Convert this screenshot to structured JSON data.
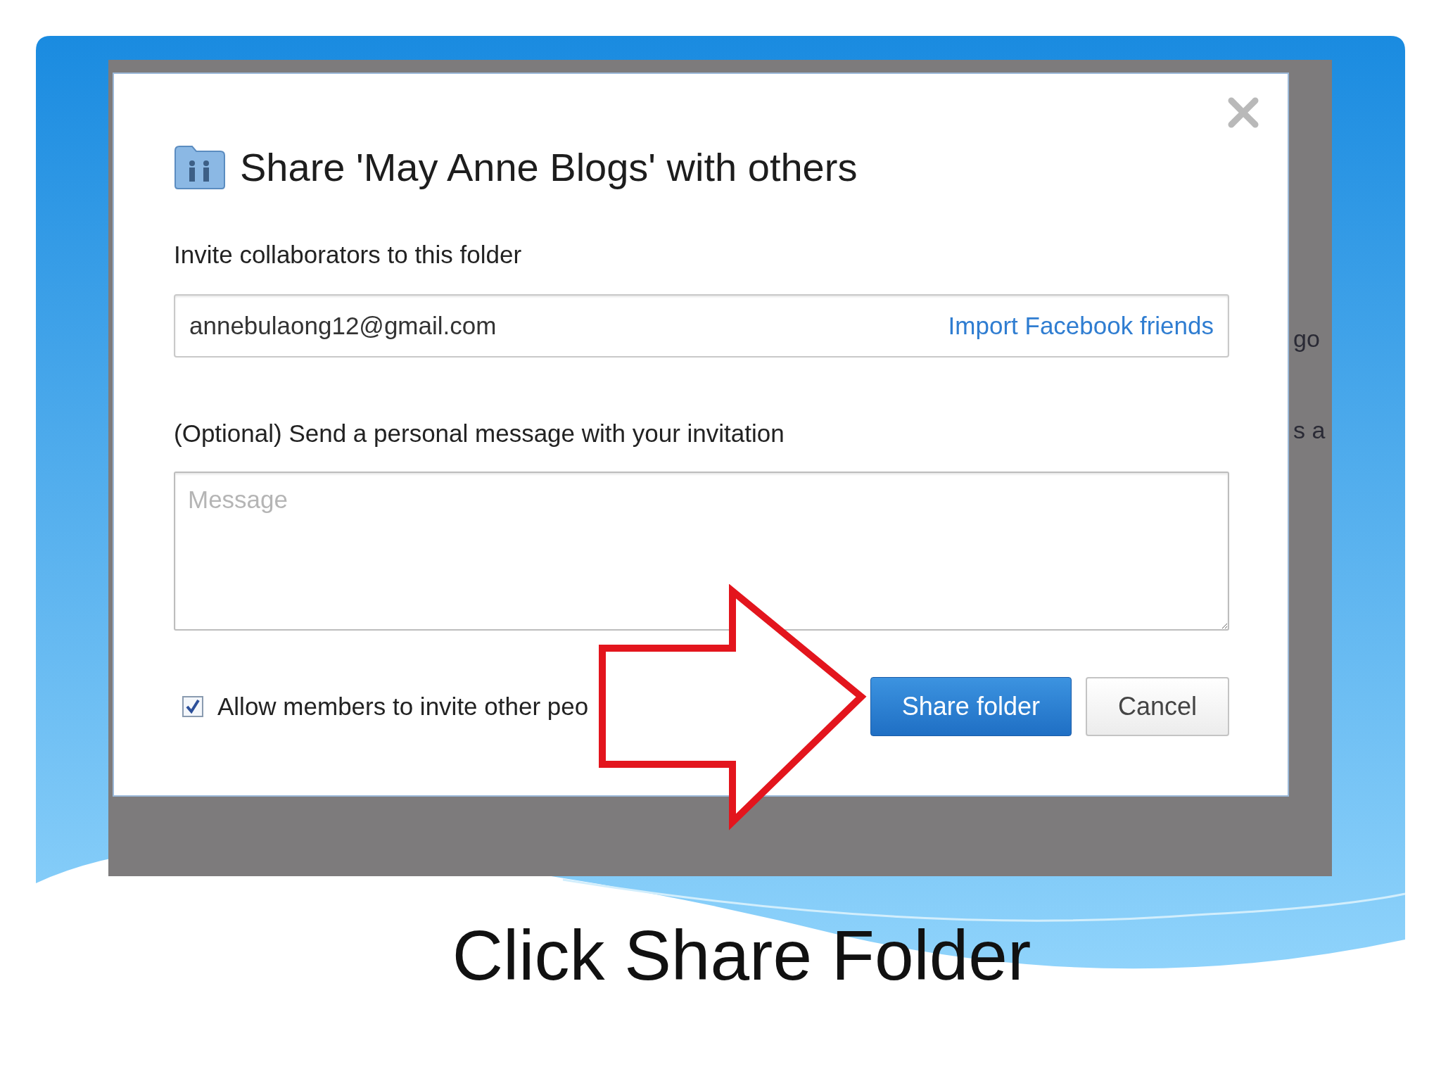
{
  "dialog": {
    "title": "Share 'May Anne Blogs' with others",
    "invite_label": "Invite collaborators to this folder",
    "invite_field": {
      "value": "annebulaong12@gmail.com"
    },
    "import_link": "Import Facebook friends",
    "message_label": "(Optional) Send a personal message with your invitation",
    "message_field": {
      "placeholder": "Message"
    },
    "allow_members": {
      "label": "Allow members to invite other peo",
      "checked": true
    },
    "buttons": [
      {
        "label": "Share folder",
        "kind": "primary"
      },
      {
        "label": "Cancel",
        "kind": "secondary"
      }
    ]
  },
  "background_fragments": [
    "go",
    "s a"
  ],
  "caption": "Click Share Folder"
}
